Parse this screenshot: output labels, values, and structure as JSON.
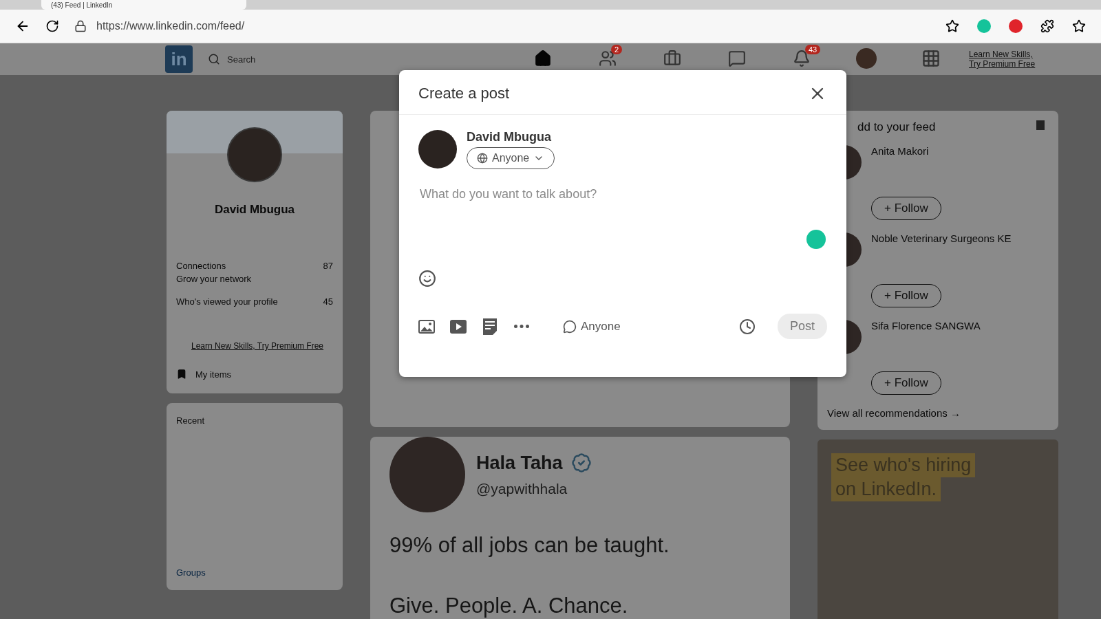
{
  "browser": {
    "tab_title": "(43) Feed | LinkedIn",
    "url": "https://www.linkedin.com/feed/"
  },
  "nav": {
    "logo": "in",
    "search_placeholder": "Search",
    "items": [
      {
        "kind": "home",
        "selected": true
      },
      {
        "kind": "network",
        "selected": false,
        "badge": "2"
      },
      {
        "kind": "jobs",
        "selected": false
      },
      {
        "kind": "messaging",
        "selected": false
      },
      {
        "kind": "notifications",
        "selected": false,
        "badge": "43"
      },
      {
        "kind": "me",
        "selected": false
      },
      {
        "kind": "apps",
        "selected": false
      }
    ],
    "premium": [
      "Learn New Skills,",
      "Try Premium Free"
    ]
  },
  "profile": {
    "name": "David Mbugua",
    "stats": [
      {
        "label": "Connections",
        "value": "87",
        "sub": "Grow your network"
      },
      {
        "label": "Who's viewed your profile",
        "value": "45"
      }
    ],
    "premium_link": "Learn New Skills, Try Premium Free",
    "my_items": "My items",
    "recent_heading": "Recent",
    "groups_heading": "Groups"
  },
  "post": {
    "author": "Hala Taha",
    "handle": "@yapwithhala",
    "verified": true,
    "lines": [
      "99% of all jobs can be taught.",
      "Give. People. A. Chance."
    ]
  },
  "suggestions": {
    "heading": "dd to your feed",
    "people": [
      {
        "name": "Anita Makori",
        "follow": "+ Follow"
      },
      {
        "name": "Noble Veterinary Surgeons KE",
        "follow": "+ Follow"
      },
      {
        "name": "Sifa Florence SANGWA",
        "follow": "+ Follow"
      }
    ],
    "view_all": "View all recommendations →"
  },
  "ad": {
    "lines": [
      "See who's hiring",
      "on LinkedIn."
    ]
  },
  "modal": {
    "title": "Create a post",
    "author": "David Mbugua",
    "audience": "Anyone",
    "placeholder": "What do you want to talk about?",
    "tools": [
      {
        "kind": "photo"
      },
      {
        "kind": "video"
      },
      {
        "kind": "document"
      },
      {
        "kind": "more"
      }
    ],
    "comment_audience": "Anyone",
    "post_button": {
      "label": "Post",
      "disabled": true
    }
  }
}
